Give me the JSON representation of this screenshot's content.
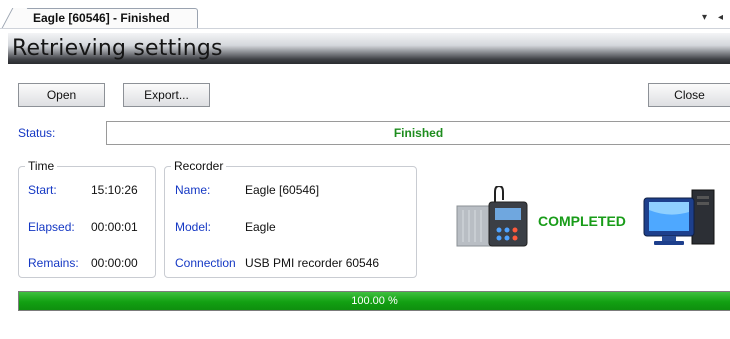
{
  "tab": {
    "title": "Eagle [60546]  - Finished",
    "dropdown_icon": "▾",
    "scroll_left_icon": "◂"
  },
  "banner": {
    "title": "Retrieving settings"
  },
  "toolbar": {
    "open_label": "Open",
    "export_label": "Export...",
    "close_label": "Close"
  },
  "status": {
    "label": "Status:",
    "value": "Finished"
  },
  "time_group": {
    "title": "Time",
    "rows": [
      {
        "label": "Start:",
        "value": "15:10:26"
      },
      {
        "label": "Elapsed:",
        "value": "00:00:01"
      },
      {
        "label": "Remains:",
        "value": "00:00:00"
      }
    ]
  },
  "recorder_group": {
    "title": "Recorder",
    "rows": [
      {
        "label": "Name:",
        "value": "Eagle [60546]"
      },
      {
        "label": "Model:",
        "value": "Eagle"
      },
      {
        "label": "Connection",
        "value": "USB PMI recorder 60546"
      }
    ]
  },
  "transfer": {
    "completed_text": "COMPLETED",
    "device_icon": "recorder-device-icon",
    "computer_icon": "computer-icon"
  },
  "progress": {
    "fraction": 1.0,
    "text": "100.00 %"
  },
  "colors": {
    "accent_blue": "#1538c4",
    "success_green": "#1e8d1e",
    "progress_green": "#12a012"
  }
}
